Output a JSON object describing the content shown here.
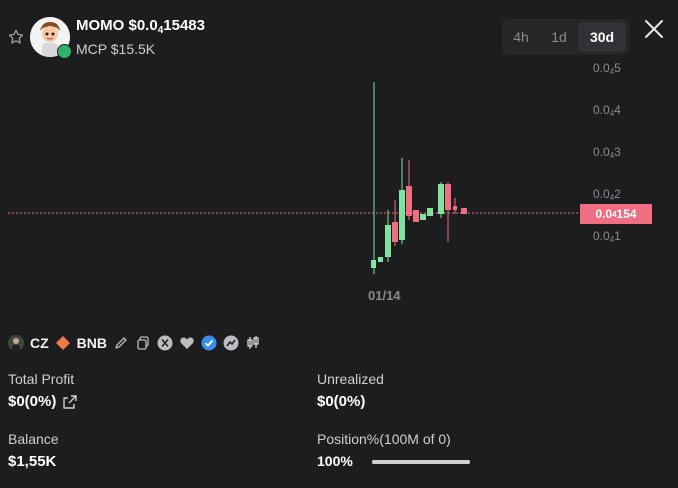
{
  "token": {
    "name": "MOMO",
    "price_prefix": "$0.0",
    "price_sub": "4",
    "price_suffix": "15483",
    "mcp_label": "MCP $15.5K"
  },
  "timeframes": [
    {
      "label": "4h",
      "active": false
    },
    {
      "label": "1d",
      "active": false
    },
    {
      "label": "30d",
      "active": true
    }
  ],
  "y_axis_labels": [
    {
      "prefix": "0.0",
      "sub": "4",
      "suffix": "5"
    },
    {
      "prefix": "0.0",
      "sub": "4",
      "suffix": "4"
    },
    {
      "prefix": "0.0",
      "sub": "4",
      "suffix": "3"
    },
    {
      "prefix": "0.0",
      "sub": "4",
      "suffix": "2"
    },
    {
      "prefix": "0.0",
      "sub": "4",
      "suffix": "1"
    }
  ],
  "current_price_tag": {
    "prefix": "0.0",
    "sub": "4",
    "suffix": "154"
  },
  "x_axis_label": "01/14",
  "dev": {
    "name": "CZ",
    "chain": "BNB"
  },
  "stats": {
    "total_profit_label": "Total Profit",
    "total_profit_value": "$0(0%)",
    "unrealized_label": "Unrealized",
    "unrealized_value": "$0(0%)",
    "balance_label": "Balance",
    "balance_value": "$1,55K",
    "position_label": "Position%(100M of 0)",
    "position_value": "100%",
    "position_fraction": 1.0
  },
  "colors": {
    "up": "#7ee2a0",
    "down": "#f06e82",
    "price_line": "#f06e82",
    "background": "#1d1d20"
  }
}
